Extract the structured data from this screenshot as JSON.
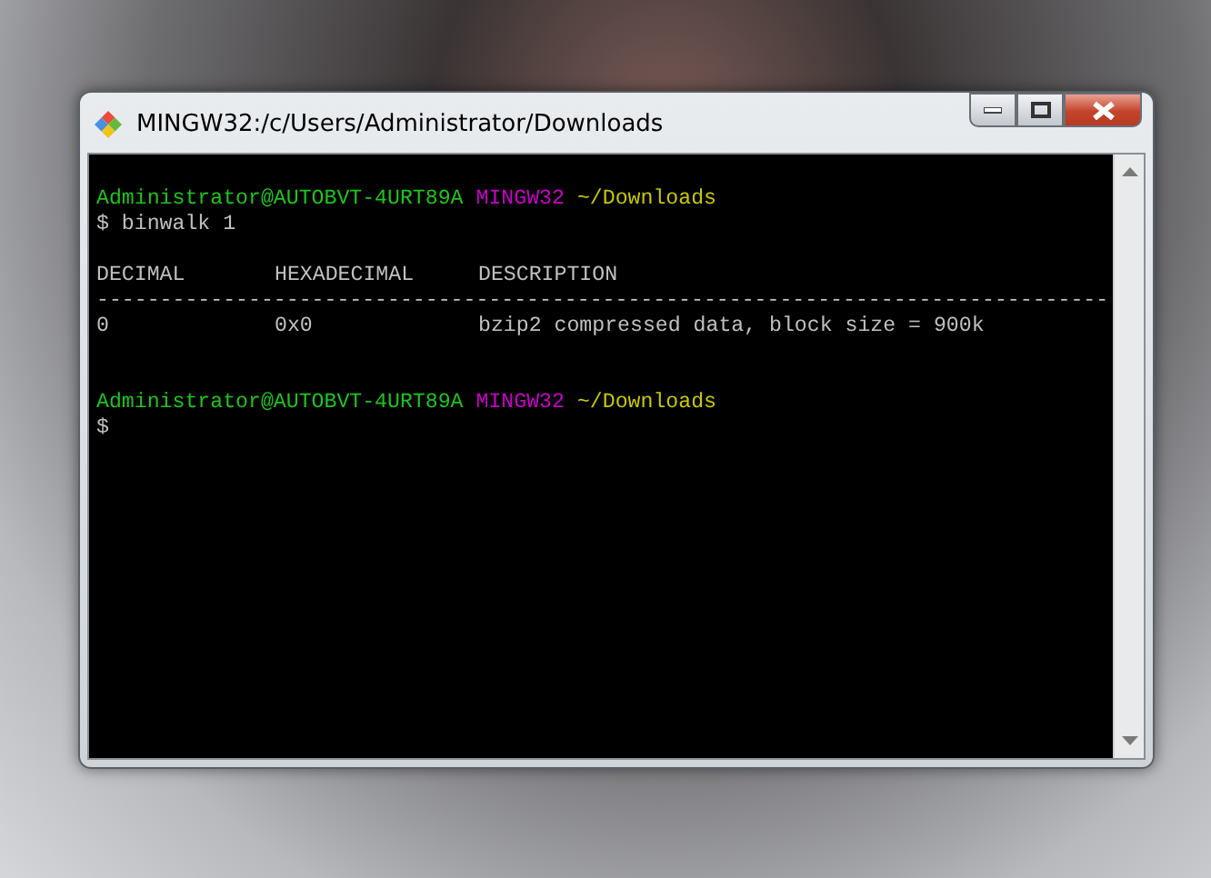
{
  "window": {
    "title": "MINGW32:/c/Users/Administrator/Downloads"
  },
  "terminal": {
    "lines": [
      {
        "kind": "blank"
      },
      {
        "kind": "prompt",
        "user_host": "Administrator@AUTOBVT-4URT89A",
        "shell": "MINGW32",
        "path": "~/Downloads"
      },
      {
        "kind": "command",
        "text": "$ binwalk 1"
      },
      {
        "kind": "blank"
      },
      {
        "kind": "table_header",
        "cells": [
          "DECIMAL",
          "HEXADECIMAL",
          "DESCRIPTION"
        ]
      },
      {
        "kind": "rule",
        "text": "--------------------------------------------------------------------------------"
      },
      {
        "kind": "table_row",
        "cells": [
          "0",
          "0x0",
          "bzip2 compressed data, block size = 900k"
        ]
      },
      {
        "kind": "blank"
      },
      {
        "kind": "blank"
      },
      {
        "kind": "prompt",
        "user_host": "Administrator@AUTOBVT-4URT89A",
        "shell": "MINGW32",
        "path": "~/Downloads"
      },
      {
        "kind": "command",
        "text": "$"
      }
    ]
  }
}
